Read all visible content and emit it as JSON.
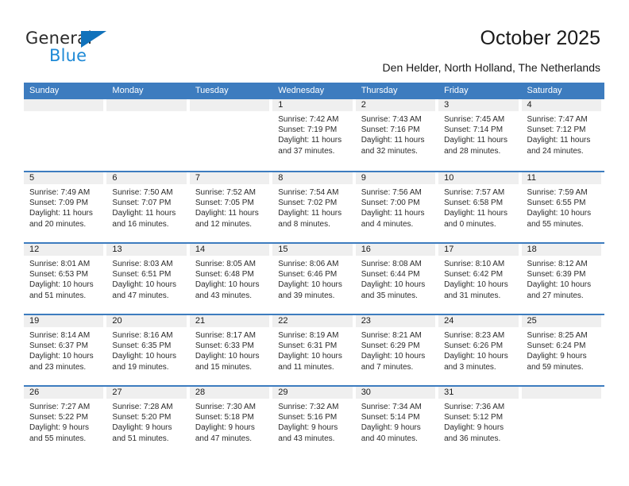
{
  "brand": {
    "name_part1": "General",
    "name_part2": "Blue",
    "accent_color": "#1172bb",
    "blue_text_color": "#1f8ad6"
  },
  "header": {
    "title": "October 2025",
    "subtitle": "Den Helder, North Holland, The Netherlands"
  },
  "calendar": {
    "header_bg": "#3d7cbf",
    "day_band_bg": "#efefef",
    "weekdays": [
      "Sunday",
      "Monday",
      "Tuesday",
      "Wednesday",
      "Thursday",
      "Friday",
      "Saturday"
    ],
    "weeks": [
      [
        {
          "day": "",
          "lines": []
        },
        {
          "day": "",
          "lines": []
        },
        {
          "day": "",
          "lines": []
        },
        {
          "day": "1",
          "lines": [
            "Sunrise: 7:42 AM",
            "Sunset: 7:19 PM",
            "Daylight: 11 hours",
            "and 37 minutes."
          ]
        },
        {
          "day": "2",
          "lines": [
            "Sunrise: 7:43 AM",
            "Sunset: 7:16 PM",
            "Daylight: 11 hours",
            "and 32 minutes."
          ]
        },
        {
          "day": "3",
          "lines": [
            "Sunrise: 7:45 AM",
            "Sunset: 7:14 PM",
            "Daylight: 11 hours",
            "and 28 minutes."
          ]
        },
        {
          "day": "4",
          "lines": [
            "Sunrise: 7:47 AM",
            "Sunset: 7:12 PM",
            "Daylight: 11 hours",
            "and 24 minutes."
          ]
        }
      ],
      [
        {
          "day": "5",
          "lines": [
            "Sunrise: 7:49 AM",
            "Sunset: 7:09 PM",
            "Daylight: 11 hours",
            "and 20 minutes."
          ]
        },
        {
          "day": "6",
          "lines": [
            "Sunrise: 7:50 AM",
            "Sunset: 7:07 PM",
            "Daylight: 11 hours",
            "and 16 minutes."
          ]
        },
        {
          "day": "7",
          "lines": [
            "Sunrise: 7:52 AM",
            "Sunset: 7:05 PM",
            "Daylight: 11 hours",
            "and 12 minutes."
          ]
        },
        {
          "day": "8",
          "lines": [
            "Sunrise: 7:54 AM",
            "Sunset: 7:02 PM",
            "Daylight: 11 hours",
            "and 8 minutes."
          ]
        },
        {
          "day": "9",
          "lines": [
            "Sunrise: 7:56 AM",
            "Sunset: 7:00 PM",
            "Daylight: 11 hours",
            "and 4 minutes."
          ]
        },
        {
          "day": "10",
          "lines": [
            "Sunrise: 7:57 AM",
            "Sunset: 6:58 PM",
            "Daylight: 11 hours",
            "and 0 minutes."
          ]
        },
        {
          "day": "11",
          "lines": [
            "Sunrise: 7:59 AM",
            "Sunset: 6:55 PM",
            "Daylight: 10 hours",
            "and 55 minutes."
          ]
        }
      ],
      [
        {
          "day": "12",
          "lines": [
            "Sunrise: 8:01 AM",
            "Sunset: 6:53 PM",
            "Daylight: 10 hours",
            "and 51 minutes."
          ]
        },
        {
          "day": "13",
          "lines": [
            "Sunrise: 8:03 AM",
            "Sunset: 6:51 PM",
            "Daylight: 10 hours",
            "and 47 minutes."
          ]
        },
        {
          "day": "14",
          "lines": [
            "Sunrise: 8:05 AM",
            "Sunset: 6:48 PM",
            "Daylight: 10 hours",
            "and 43 minutes."
          ]
        },
        {
          "day": "15",
          "lines": [
            "Sunrise: 8:06 AM",
            "Sunset: 6:46 PM",
            "Daylight: 10 hours",
            "and 39 minutes."
          ]
        },
        {
          "day": "16",
          "lines": [
            "Sunrise: 8:08 AM",
            "Sunset: 6:44 PM",
            "Daylight: 10 hours",
            "and 35 minutes."
          ]
        },
        {
          "day": "17",
          "lines": [
            "Sunrise: 8:10 AM",
            "Sunset: 6:42 PM",
            "Daylight: 10 hours",
            "and 31 minutes."
          ]
        },
        {
          "day": "18",
          "lines": [
            "Sunrise: 8:12 AM",
            "Sunset: 6:39 PM",
            "Daylight: 10 hours",
            "and 27 minutes."
          ]
        }
      ],
      [
        {
          "day": "19",
          "lines": [
            "Sunrise: 8:14 AM",
            "Sunset: 6:37 PM",
            "Daylight: 10 hours",
            "and 23 minutes."
          ]
        },
        {
          "day": "20",
          "lines": [
            "Sunrise: 8:16 AM",
            "Sunset: 6:35 PM",
            "Daylight: 10 hours",
            "and 19 minutes."
          ]
        },
        {
          "day": "21",
          "lines": [
            "Sunrise: 8:17 AM",
            "Sunset: 6:33 PM",
            "Daylight: 10 hours",
            "and 15 minutes."
          ]
        },
        {
          "day": "22",
          "lines": [
            "Sunrise: 8:19 AM",
            "Sunset: 6:31 PM",
            "Daylight: 10 hours",
            "and 11 minutes."
          ]
        },
        {
          "day": "23",
          "lines": [
            "Sunrise: 8:21 AM",
            "Sunset: 6:29 PM",
            "Daylight: 10 hours",
            "and 7 minutes."
          ]
        },
        {
          "day": "24",
          "lines": [
            "Sunrise: 8:23 AM",
            "Sunset: 6:26 PM",
            "Daylight: 10 hours",
            "and 3 minutes."
          ]
        },
        {
          "day": "25",
          "lines": [
            "Sunrise: 8:25 AM",
            "Sunset: 6:24 PM",
            "Daylight: 9 hours",
            "and 59 minutes."
          ]
        }
      ],
      [
        {
          "day": "26",
          "lines": [
            "Sunrise: 7:27 AM",
            "Sunset: 5:22 PM",
            "Daylight: 9 hours",
            "and 55 minutes."
          ]
        },
        {
          "day": "27",
          "lines": [
            "Sunrise: 7:28 AM",
            "Sunset: 5:20 PM",
            "Daylight: 9 hours",
            "and 51 minutes."
          ]
        },
        {
          "day": "28",
          "lines": [
            "Sunrise: 7:30 AM",
            "Sunset: 5:18 PM",
            "Daylight: 9 hours",
            "and 47 minutes."
          ]
        },
        {
          "day": "29",
          "lines": [
            "Sunrise: 7:32 AM",
            "Sunset: 5:16 PM",
            "Daylight: 9 hours",
            "and 43 minutes."
          ]
        },
        {
          "day": "30",
          "lines": [
            "Sunrise: 7:34 AM",
            "Sunset: 5:14 PM",
            "Daylight: 9 hours",
            "and 40 minutes."
          ]
        },
        {
          "day": "31",
          "lines": [
            "Sunrise: 7:36 AM",
            "Sunset: 5:12 PM",
            "Daylight: 9 hours",
            "and 36 minutes."
          ]
        },
        {
          "day": "",
          "lines": []
        }
      ]
    ]
  }
}
